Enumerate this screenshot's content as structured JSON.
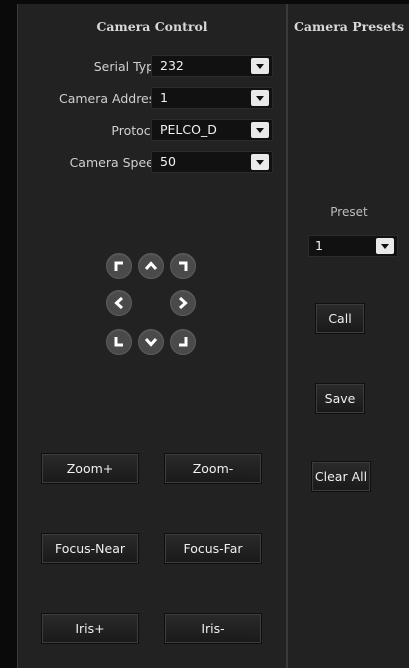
{
  "camera_control": {
    "title": "Camera Control",
    "fields": [
      {
        "label": "Serial Type:",
        "value": "232"
      },
      {
        "label": "Camera Address:",
        "value": "1"
      },
      {
        "label": "Protocol:",
        "value": "PELCO_D"
      },
      {
        "label": "Camera Speed:",
        "value": "50"
      }
    ],
    "buttons": {
      "zoom_in": "Zoom+",
      "zoom_out": "Zoom-",
      "focus_near": "Focus-Near",
      "focus_far": "Focus-Far",
      "iris_open": "Iris+",
      "iris_close": "Iris-"
    },
    "dpad_icons": [
      "arrow-up-left-icon",
      "arrow-up-icon",
      "arrow-up-right-icon",
      "arrow-left-icon",
      "arrow-right-icon",
      "arrow-down-left-icon",
      "arrow-down-icon",
      "arrow-down-right-icon"
    ]
  },
  "camera_presets": {
    "title": "Camera Presets",
    "preset_label": "Preset",
    "preset_value": "1",
    "buttons": {
      "call": "Call",
      "save": "Save",
      "clear_all": "Clear All"
    }
  },
  "colors": {
    "background": "#0a0a0a",
    "panel": "#222222",
    "dropdown_bg": "#111111",
    "dpad": "#4a4a4a",
    "text": "#e8e8e8"
  }
}
